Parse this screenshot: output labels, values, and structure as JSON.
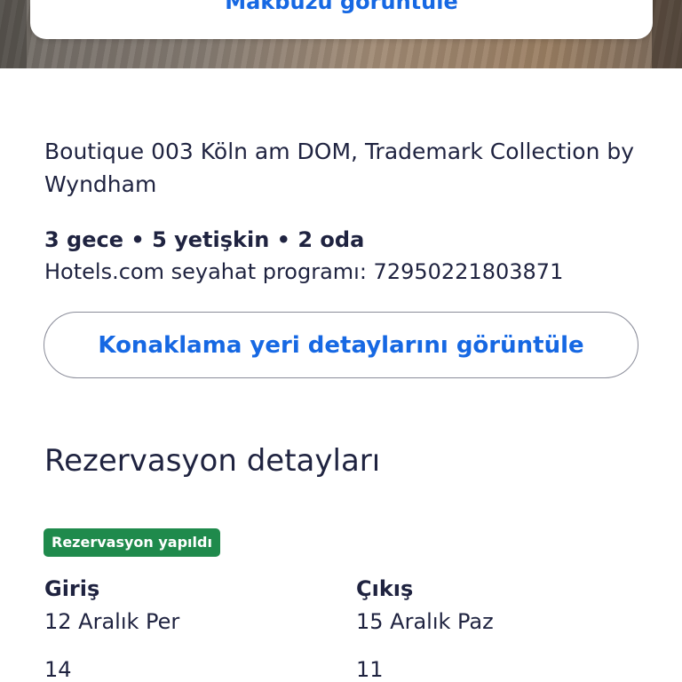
{
  "header": {
    "receipt_link": "Makbuzu görüntüle"
  },
  "hotel": {
    "name": "Boutique 003 Köln am DOM, Trademark Collection by Wyndham",
    "stay_summary": "3 gece • 5 yetişkin • 2 oda",
    "itinerary": "Hotels.com seyahat programı: 72950221803871",
    "details_button": "Konaklama yeri detaylarını görüntüle"
  },
  "reservation": {
    "title": "Rezervasyon detayları",
    "status": "Rezervasyon yapıldı",
    "check_in": {
      "label": "Giriş",
      "date": "12 Aralık Per",
      "time": "14"
    },
    "check_out": {
      "label": "Çıkış",
      "date": "15 Aralık Paz",
      "time": "11"
    }
  },
  "colors": {
    "link": "#1668e3",
    "text": "#1f2340",
    "status_badge": "#1f8a4c"
  }
}
